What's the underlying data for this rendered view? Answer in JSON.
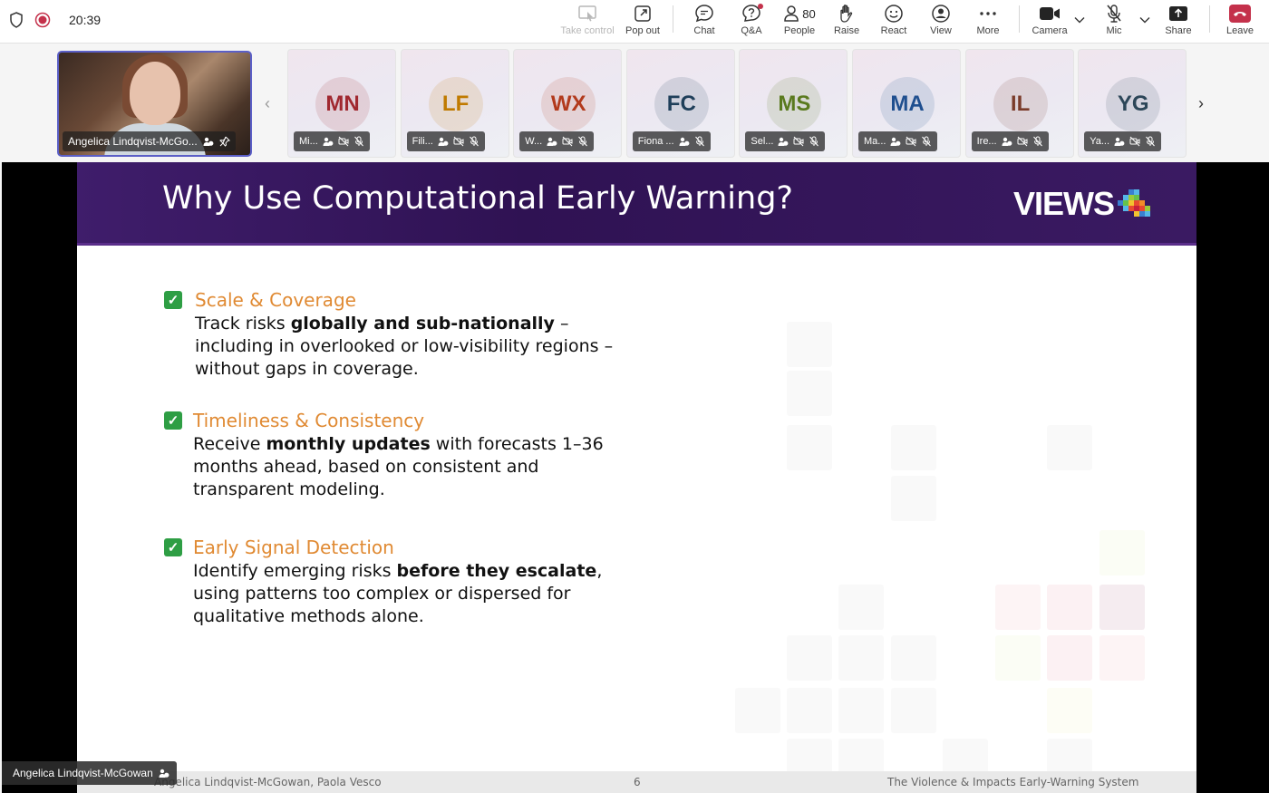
{
  "status": {
    "time": "20:39"
  },
  "toolbar": {
    "take_control": "Take control",
    "pop_out": "Pop out",
    "chat": "Chat",
    "qa": "Q&A",
    "people": "People",
    "people_count": "80",
    "raise": "Raise",
    "react": "React",
    "view": "View",
    "more": "More",
    "camera": "Camera",
    "mic": "Mic",
    "share": "Share",
    "leave": "Leave"
  },
  "self_tile": {
    "name": "Angelica Lindqvist-McGo..."
  },
  "participants": [
    {
      "initials": "MN",
      "label": "Mi...",
      "color": "#a0282f"
    },
    {
      "initials": "LF",
      "label": "Fili...",
      "color": "#c07a00"
    },
    {
      "initials": "WX",
      "label": "W...",
      "color": "#b23a1c"
    },
    {
      "initials": "FC",
      "label": "Fiona ...",
      "color": "#1f3f5a"
    },
    {
      "initials": "MS",
      "label": "Sel...",
      "color": "#5a7a1e"
    },
    {
      "initials": "MA",
      "label": "Ma...",
      "color": "#1f4f8f"
    },
    {
      "initials": "IL",
      "label": "Ire...",
      "color": "#7a3b2a"
    },
    {
      "initials": "YG",
      "label": "Ya...",
      "color": "#2c4658"
    }
  ],
  "slide": {
    "title": "Why Use Computational Early Warning?",
    "logo": "VIEWS",
    "bullets": [
      {
        "heading": "Scale & Coverage",
        "pre": "Track risks ",
        "bold": "globally and sub-nationally",
        "post": " – including in overlooked or low-visibility regions – without gaps in coverage."
      },
      {
        "heading": "Timeliness & Consistency",
        "pre": "Receive ",
        "bold": "monthly updates",
        "post": " with forecasts 1–36 months ahead, based on consistent and transparent modeling."
      },
      {
        "heading": "Early Signal Detection",
        "pre": "Identify emerging risks ",
        "bold": "before they escalate",
        "post": ", using patterns too complex or dispersed for qualitative methods alone."
      }
    ],
    "footer_left": "Angelica Lindqvist-McGowan, Paola Vesco",
    "footer_page": "6",
    "footer_right": "The Violence & Impacts Early-Warning System"
  },
  "speaker": {
    "name": "Angelica Lindqvist-McGowan"
  },
  "colors": {
    "accent": "#5b5fc7",
    "leave": "#c4314b",
    "slide_header": "#2f1253",
    "bullet_heading": "#e08a33",
    "check": "#2e9e44"
  }
}
